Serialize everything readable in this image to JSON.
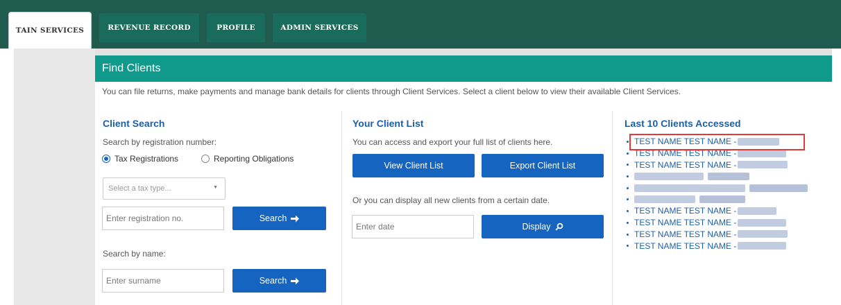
{
  "tabs": [
    {
      "label": "TAIN SERVICES",
      "active": true
    },
    {
      "label": "REVENUE RECORD",
      "active": false
    },
    {
      "label": "PROFILE",
      "active": false
    },
    {
      "label": "ADMIN SERVICES",
      "active": false
    }
  ],
  "banner_title": "Find Clients",
  "intro": "You can file returns, make payments and manage bank details for clients through Client Services. Select a client below to view their available Client Services.",
  "client_search": {
    "title": "Client Search",
    "by_reg_label": "Search by registration number:",
    "radio_tax": "Tax Registrations",
    "radio_reporting": "Reporting Obligations",
    "tax_type_placeholder": "Select a tax type...",
    "reg_placeholder": "Enter registration no.",
    "search_label": "Search",
    "by_name_label": "Search by name:",
    "surname_placeholder": "Enter surname"
  },
  "client_list": {
    "title": "Your Client List",
    "description": "You can access and export your full list of clients here.",
    "view_button": "View Client List",
    "export_button": "Export Client List",
    "date_description": "Or you can display all new clients from a certain date.",
    "date_placeholder": "Enter date",
    "display_button": "Display"
  },
  "recent_clients": {
    "title": "Last 10 Clients Accessed",
    "items": [
      "TEST NAME TEST NAME -",
      "TEST NAME TEST NAME -",
      "TEST NAME TEST NAME -",
      "",
      "",
      "",
      "TEST NAME TEST NAME -",
      "TEST NAME TEST NAME -",
      "TEST NAME TEST NAME -",
      "TEST NAME TEST NAME -"
    ]
  },
  "colors": {
    "topbar": "#1f5c4f",
    "tab": "#196b5b",
    "banner": "#0f9a8b",
    "primary_button": "#1565c0",
    "link": "#1d5fa8",
    "highlight_box": "#e23a3a"
  },
  "icons": {
    "search_button": "arrow-right-icon",
    "display_button": "magnifier-icon",
    "select_caret": "chevron-down-icon"
  }
}
